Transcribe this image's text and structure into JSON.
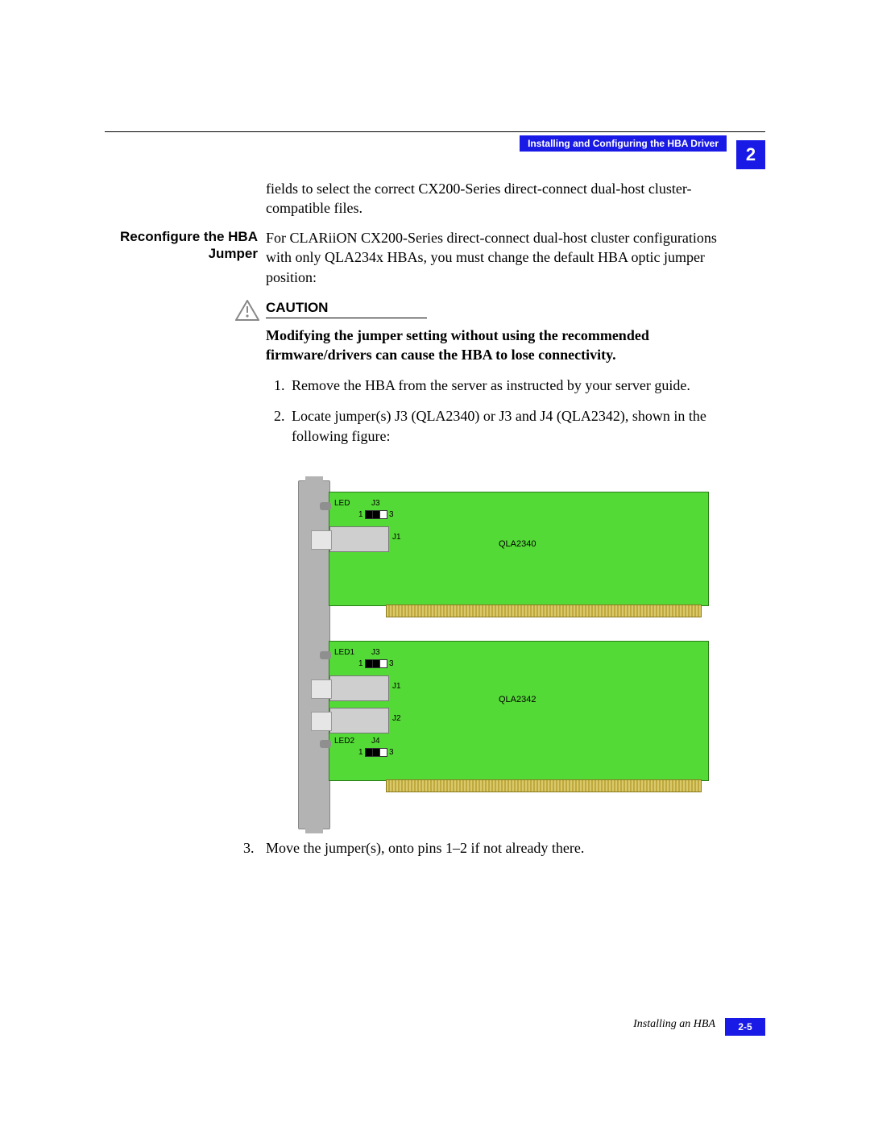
{
  "header": {
    "section_title": "Installing and Configuring the HBA Driver",
    "chapter_number": "2"
  },
  "lead_paragraph": "fields to select the correct CX200-Series direct-connect dual-host cluster-compatible files.",
  "side_head": "Reconfigure the HBA Jumper",
  "body_paragraph": "For CLARiiON CX200-Series direct-connect dual-host cluster configurations with only QLA234x HBAs, you must change the default HBA optic jumper position:",
  "caution": {
    "heading": "CAUTION",
    "body": "Modifying the jumper setting without using the recommended firmware/drivers can cause the HBA to lose connectivity."
  },
  "steps": [
    "Remove the HBA from the server as instructed by your server guide.",
    "Locate jumper(s) J3 (QLA2340) or J3 and J4 (QLA2342), shown in the following figure:",
    "Move the jumper(s), onto pins 1–2 if not already there."
  ],
  "step3_num": "3.",
  "diagram": {
    "card_a": {
      "name": "QLA2340",
      "labels": {
        "led": "LED",
        "j3": "J3",
        "j1": "J1",
        "pin1": "1",
        "pin3": "3"
      }
    },
    "card_b": {
      "name": "QLA2342",
      "labels": {
        "led1": "LED1",
        "led2": "LED2",
        "j3": "J3",
        "j4": "J4",
        "j1": "J1",
        "j2": "J2",
        "pin1": "1",
        "pin3": "3"
      }
    }
  },
  "footer": {
    "text": "Installing an HBA",
    "page": "2-5"
  }
}
